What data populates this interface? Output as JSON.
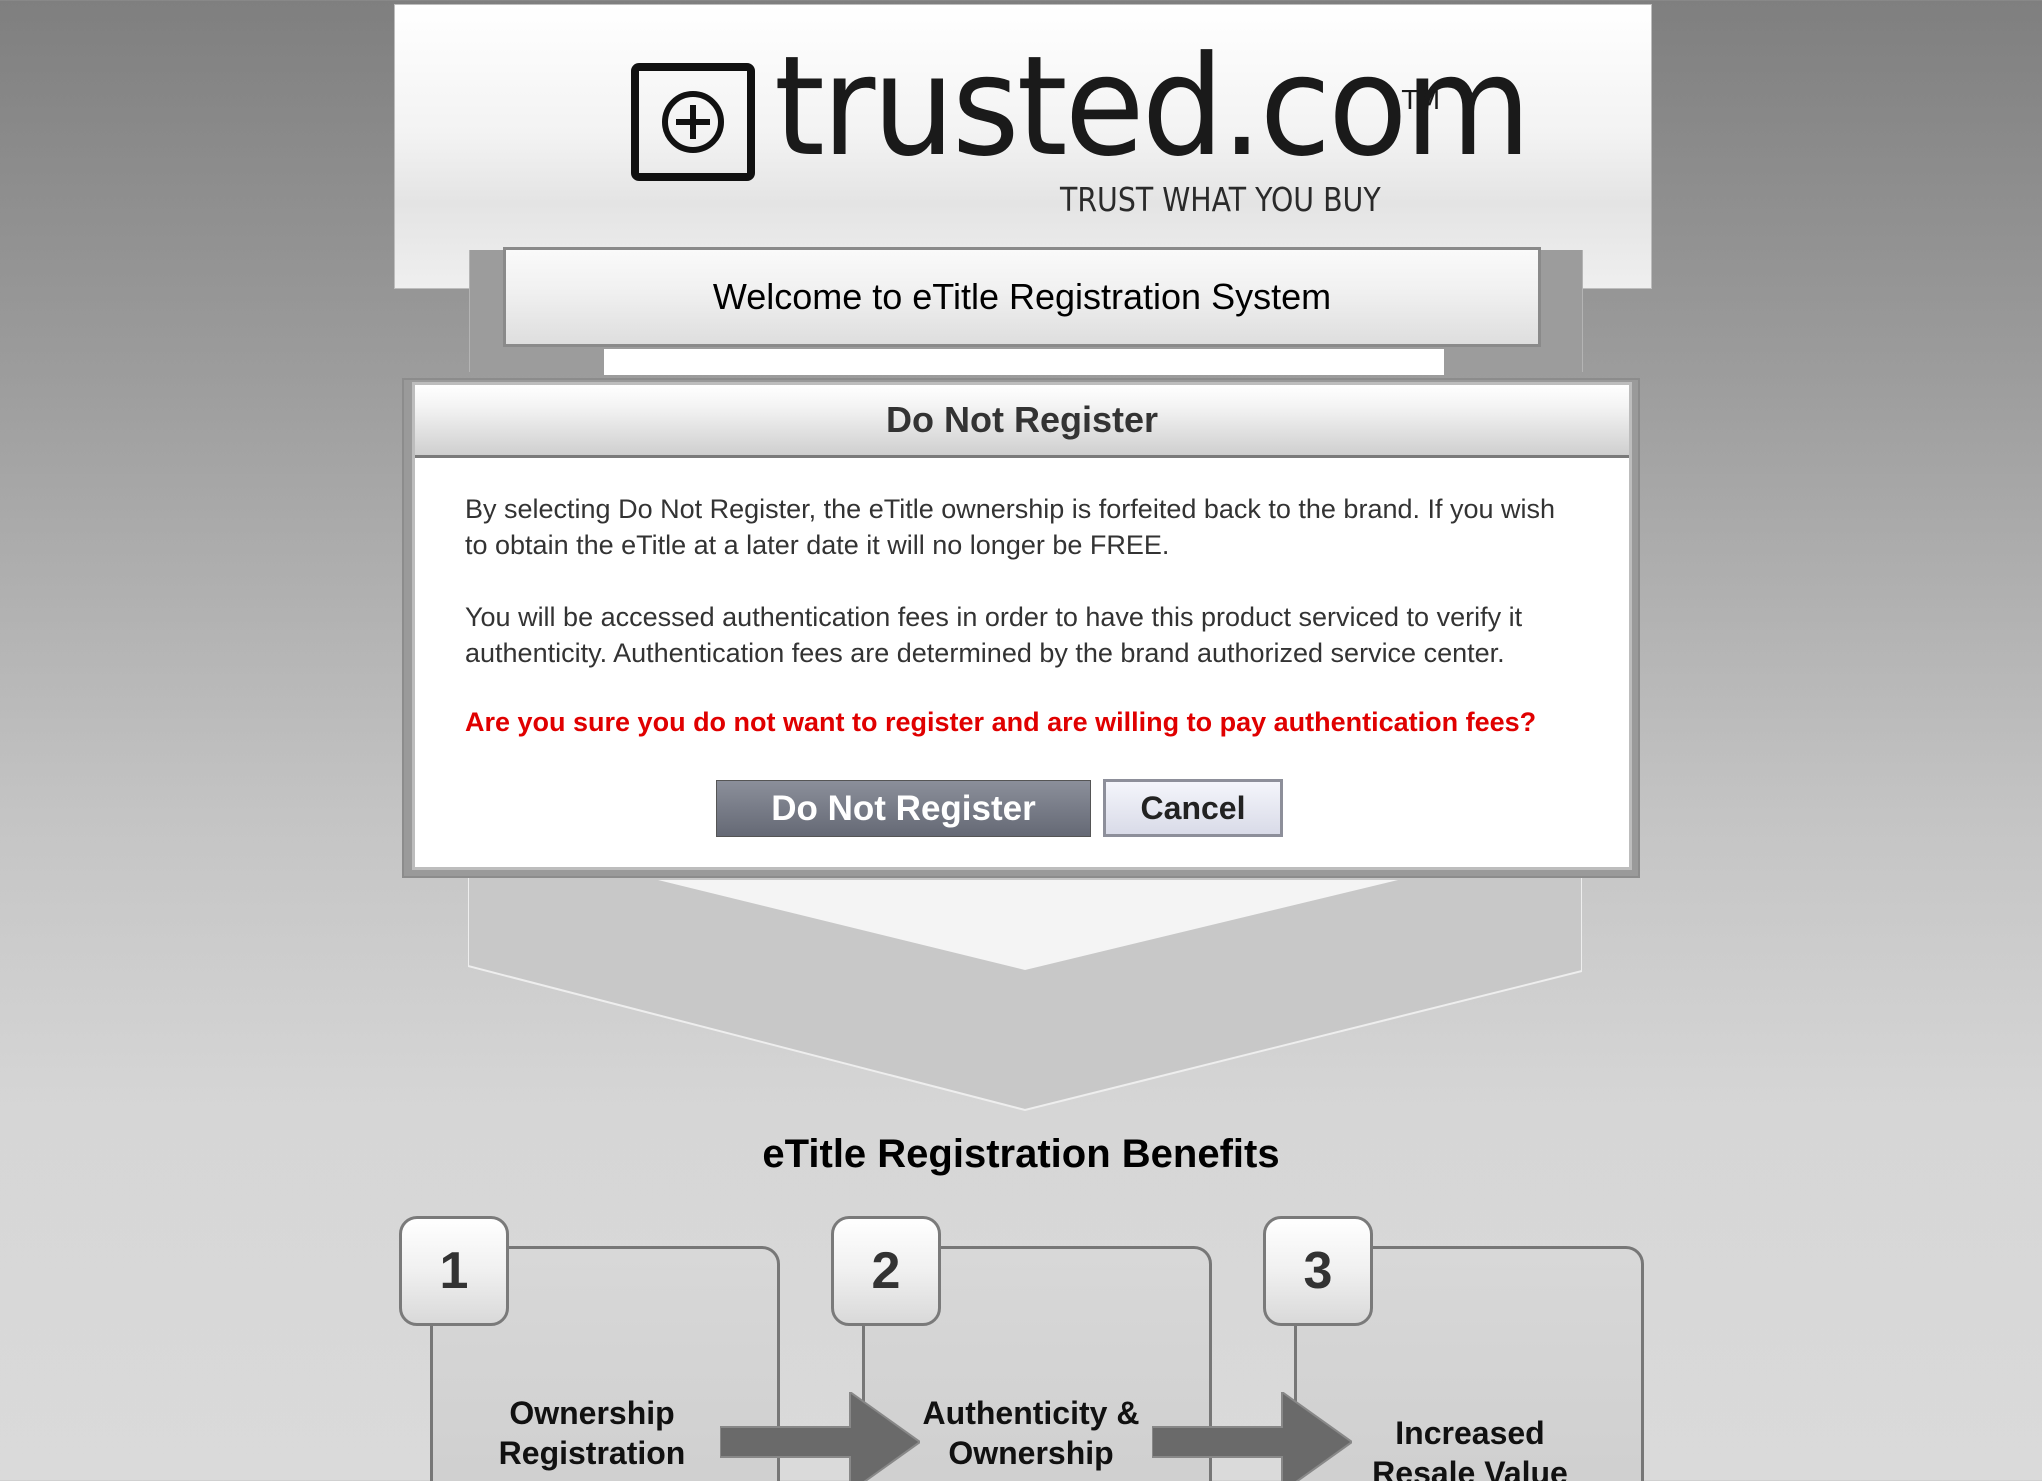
{
  "header": {
    "logo_word": "trusted.com",
    "logo_tm": "TM",
    "tagline": "TRUST WHAT YOU BUY"
  },
  "welcome": {
    "title": "Welcome to eTitle Registration System"
  },
  "modal": {
    "title": "Do Not Register",
    "paragraph1": "By selecting Do Not Register, the eTitle ownership is forfeited back to the brand. If you wish to obtain the eTitle at a later date it will no longer be FREE.",
    "paragraph2": "You will be accessed authentication fees in order to have this product serviced to verify it authenticity. Authentication fees are determined by the brand authorized service center.",
    "warning": "Are you sure you do not want to register and are willing to pay authentication fees?",
    "confirm_label": "Do Not Register",
    "cancel_label": "Cancel",
    "warning_color": "#e00000"
  },
  "benefits": {
    "title": "eTitle Registration Benefits",
    "items": [
      {
        "number": "1",
        "label": "Ownership Registration"
      },
      {
        "number": "2",
        "label": "Authenticity & Ownership"
      },
      {
        "number": "3",
        "label": "Increased Resale Value"
      }
    ]
  }
}
